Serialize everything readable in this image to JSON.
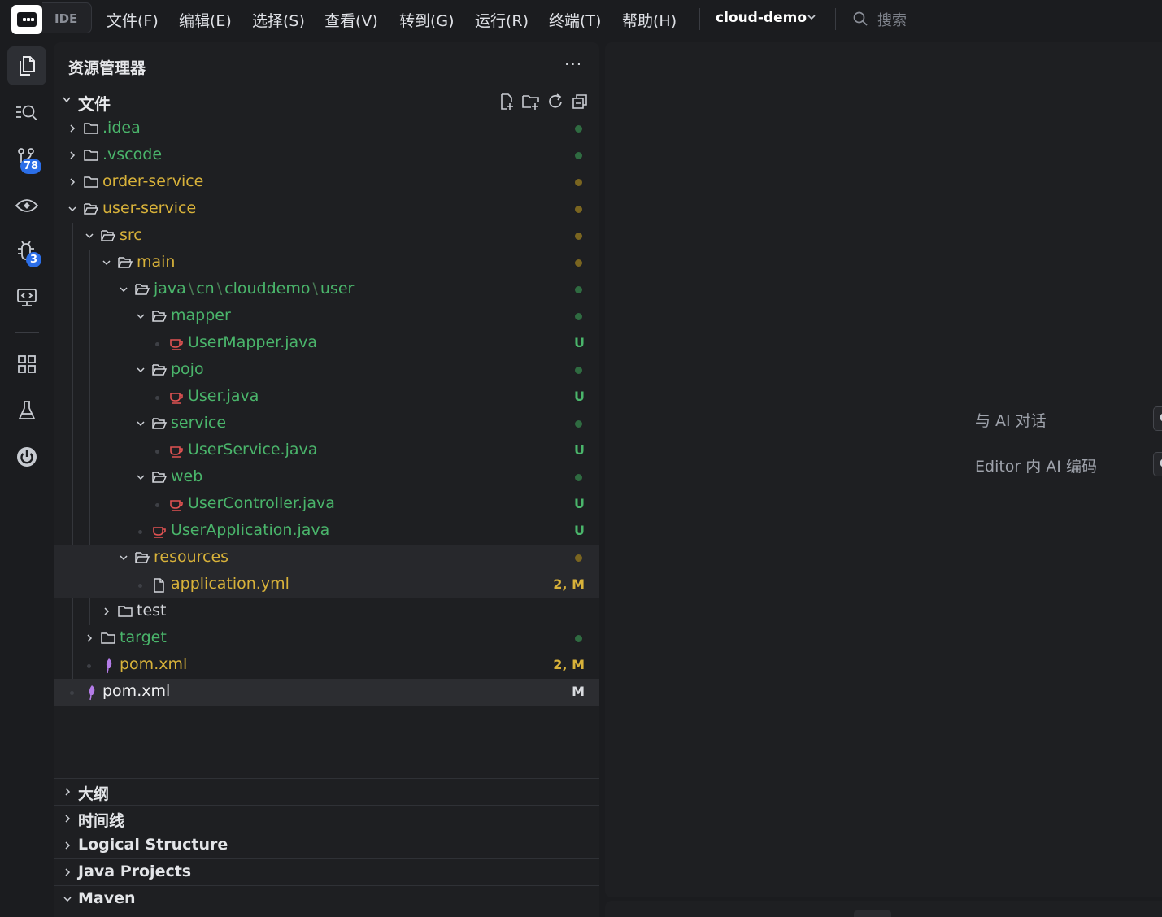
{
  "topbar": {
    "app_label": "IDE",
    "menu": [
      "文件(F)",
      "编辑(E)",
      "选择(S)",
      "查看(V)",
      "转到(G)",
      "运行(R)",
      "终端(T)",
      "帮助(H)"
    ],
    "project": "cloud-demo",
    "search_placeholder": "搜索"
  },
  "activitybar": {
    "items": [
      {
        "icon": "explorer-icon",
        "active": true
      },
      {
        "icon": "search-icon"
      },
      {
        "icon": "source-control-icon",
        "badge": "78"
      },
      {
        "icon": "preview-eye-icon"
      },
      {
        "icon": "run-debug-icon",
        "badge": "3"
      },
      {
        "icon": "remote-explorer-icon"
      },
      {
        "icon": "extensions-icon"
      },
      {
        "icon": "testing-flask-icon"
      },
      {
        "icon": "spring-power-icon"
      }
    ]
  },
  "sidebar": {
    "title": "资源管理器",
    "more": "···",
    "files_label": "文件",
    "tools": [
      "new-file-icon",
      "new-folder-icon",
      "refresh-icon",
      "collapse-all-icon"
    ],
    "tree": [
      {
        "label": ".idea",
        "type": "folder",
        "open": false,
        "depth": 0,
        "color": "green",
        "dot": "green"
      },
      {
        "label": ".vscode",
        "type": "folder",
        "open": false,
        "depth": 0,
        "color": "green",
        "dot": "green"
      },
      {
        "label": "order-service",
        "type": "folder",
        "open": false,
        "depth": 0,
        "color": "yellow",
        "dot": "yellow"
      },
      {
        "label": "user-service",
        "type": "folder",
        "open": true,
        "depth": 0,
        "color": "yellow",
        "dot": "yellow"
      },
      {
        "label": "src",
        "type": "folder",
        "open": true,
        "depth": 1,
        "color": "yellow",
        "dot": "yellow"
      },
      {
        "label": "main",
        "type": "folder",
        "open": true,
        "depth": 2,
        "color": "yellow",
        "dot": "yellow"
      },
      {
        "label": "java\\cn\\clouddemo\\user",
        "parts": [
          "java",
          "cn",
          "clouddemo",
          "user"
        ],
        "type": "folder",
        "open": true,
        "depth": 3,
        "color": "green",
        "dot": "green"
      },
      {
        "label": "mapper",
        "type": "folder",
        "open": true,
        "depth": 4,
        "color": "green",
        "dot": "green"
      },
      {
        "label": "UserMapper.java",
        "type": "java",
        "depth": 5,
        "color": "green",
        "status": "U"
      },
      {
        "label": "pojo",
        "type": "folder",
        "open": true,
        "depth": 4,
        "color": "green",
        "dot": "green"
      },
      {
        "label": "User.java",
        "type": "java",
        "depth": 5,
        "color": "green",
        "status": "U"
      },
      {
        "label": "service",
        "type": "folder",
        "open": true,
        "depth": 4,
        "color": "green",
        "dot": "green"
      },
      {
        "label": "UserService.java",
        "type": "java",
        "depth": 5,
        "color": "green",
        "status": "U"
      },
      {
        "label": "web",
        "type": "folder",
        "open": true,
        "depth": 4,
        "color": "green",
        "dot": "green"
      },
      {
        "label": "UserController.java",
        "type": "java",
        "depth": 5,
        "color": "green",
        "status": "U"
      },
      {
        "label": "UserApplication.java",
        "type": "java",
        "depth": 4,
        "color": "green",
        "status": "U"
      },
      {
        "label": "resources",
        "type": "folder",
        "open": true,
        "depth": 3,
        "color": "yellow",
        "dot": "yellow",
        "highlight": "hover"
      },
      {
        "label": "application.yml",
        "type": "file",
        "depth": 4,
        "color": "yellow",
        "status": "2, M",
        "highlight": "hover"
      },
      {
        "label": "test",
        "type": "folder",
        "open": false,
        "depth": 2,
        "color": "plain"
      },
      {
        "label": "target",
        "type": "folder",
        "open": false,
        "depth": 1,
        "color": "green",
        "dot": "green"
      },
      {
        "label": "pom.xml",
        "type": "xml",
        "depth": 1,
        "color": "yellow",
        "status": "2, M"
      },
      {
        "label": "pom.xml",
        "type": "xml",
        "depth": 0,
        "color": "white",
        "status": "M",
        "highlight": "selected"
      }
    ],
    "sections": [
      {
        "label": "大纲",
        "open": false
      },
      {
        "label": "时间线",
        "open": false
      },
      {
        "label": "Logical Structure",
        "open": false
      },
      {
        "label": "Java Projects",
        "open": false
      },
      {
        "label": "Maven",
        "open": true
      }
    ]
  },
  "editor": {
    "hints": [
      {
        "label": "与 AI 对话",
        "key": "C"
      },
      {
        "label": "Editor 内 AI 编码",
        "key": "C"
      }
    ]
  },
  "colors": {
    "background": "#1b1c1f",
    "panel": "#1e1f22",
    "untracked_green": "#4ab56b",
    "modified_yellow": "#d8b23a",
    "java_icon_red": "#e05252",
    "xml_icon_purple": "#b47ce8",
    "badge_blue": "#2b6ee8"
  }
}
